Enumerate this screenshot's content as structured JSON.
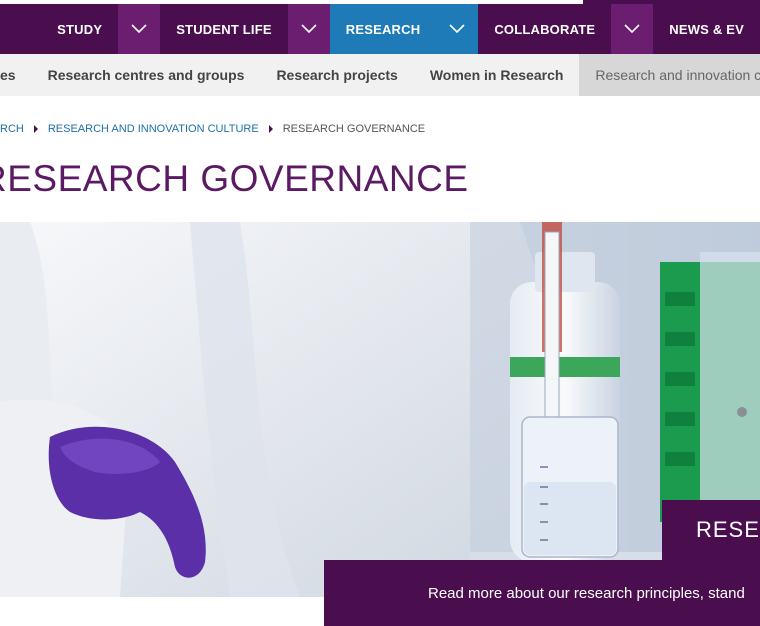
{
  "nav": {
    "items": [
      {
        "label": "STUDY",
        "active": false
      },
      {
        "label": "STUDENT LIFE",
        "active": false
      },
      {
        "label": "RESEARCH",
        "active": true
      },
      {
        "label": "COLLABORATE",
        "active": false
      },
      {
        "label": "NEWS & EV",
        "active": false
      }
    ]
  },
  "subnav": {
    "items": [
      {
        "label": "es",
        "active": false
      },
      {
        "label": "Research centres and groups",
        "active": false
      },
      {
        "label": "Research projects",
        "active": false
      },
      {
        "label": "Women in Research",
        "active": false
      },
      {
        "label": "Research and innovation culture",
        "active": true
      }
    ]
  },
  "breadcrumb": {
    "items": [
      "RCH",
      "RESEARCH AND INNOVATION CULTURE"
    ],
    "current": "RESEARCH GOVERNANCE"
  },
  "page": {
    "title": "RESEARCH GOVERNANCE"
  },
  "hero": {
    "tag": "RESE",
    "caption": "Read more about our research principles, stand"
  },
  "colors": {
    "brand_purple": "#4a0d4e",
    "toggle_purple": "#6b1e70",
    "active_blue": "#1f7ab8",
    "title_purple": "#5b1a63",
    "link_blue": "#1f6fa8"
  }
}
